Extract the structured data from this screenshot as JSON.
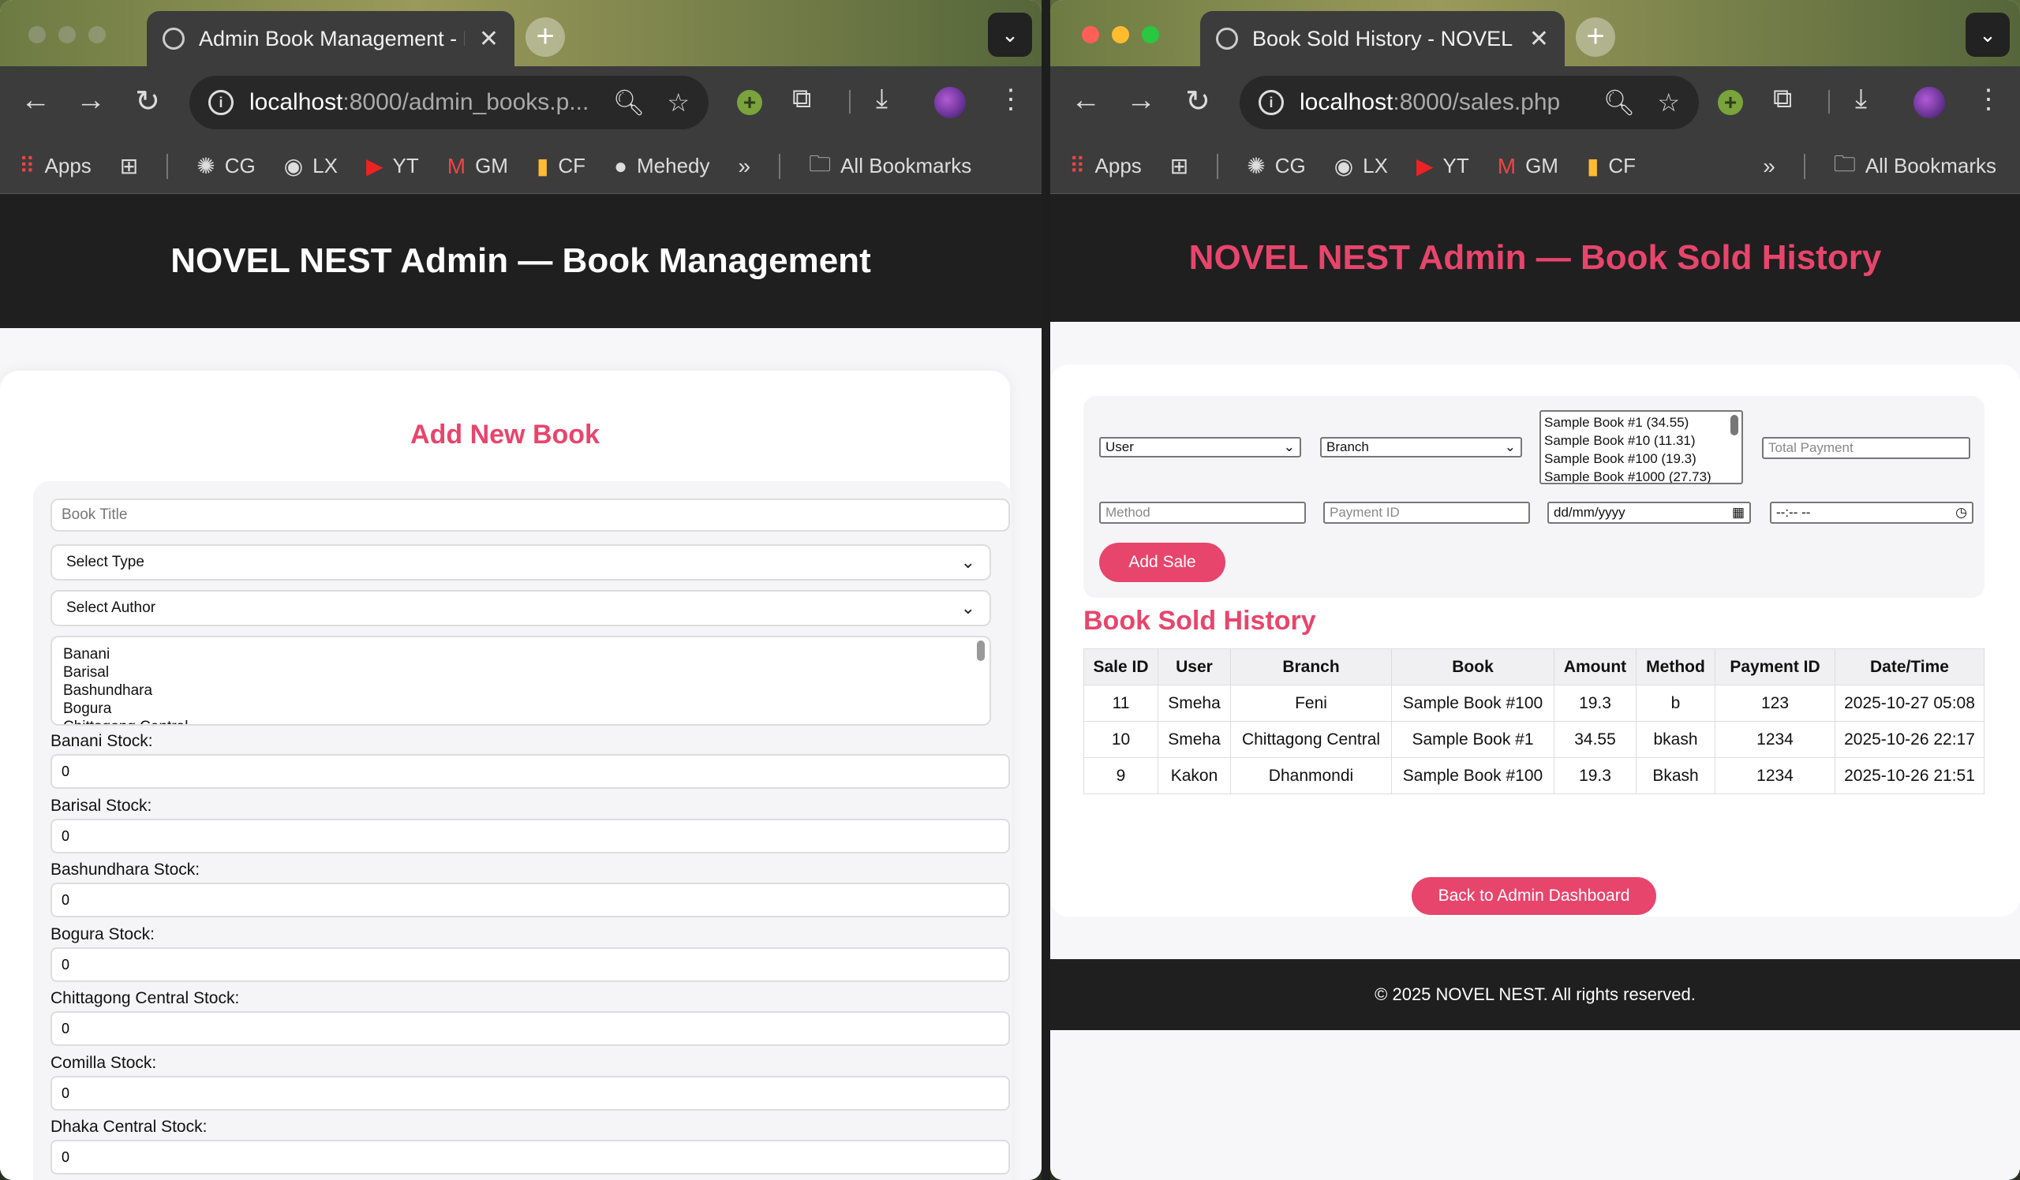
{
  "left": {
    "tab_title": "Admin Book Management - N",
    "url_host": "localhost",
    "url_path": ":8000/admin_books.p...",
    "bookmarks": [
      "Apps",
      "CG",
      "LX",
      "YT",
      "GM",
      "CF",
      "Mehedy",
      "All Bookmarks"
    ],
    "header": "NOVEL NEST Admin — Book Management",
    "card_title": "Add New Book",
    "book_title_placeholder": "Book Title",
    "select_type": "Select Type",
    "select_author": "Select Author",
    "branches": [
      "Banani",
      "Barisal",
      "Bashundhara",
      "Bogura",
      "Chittagong Central"
    ],
    "stocks": [
      {
        "label": "Banani Stock:",
        "value": "0"
      },
      {
        "label": "Barisal Stock:",
        "value": "0"
      },
      {
        "label": "Bashundhara Stock:",
        "value": "0"
      },
      {
        "label": "Bogura Stock:",
        "value": "0"
      },
      {
        "label": "Chittagong Central Stock:",
        "value": "0"
      },
      {
        "label": "Comilla Stock:",
        "value": "0"
      },
      {
        "label": "Dhaka Central Stock:",
        "value": "0"
      }
    ]
  },
  "right": {
    "tab_title": "Book Sold History - NOVEL N",
    "url_host": "localhost",
    "url_path": ":8000/sales.php",
    "bookmarks": [
      "Apps",
      "CG",
      "LX",
      "YT",
      "GM",
      "CF",
      "All Bookmarks"
    ],
    "header": "NOVEL NEST Admin — Book Sold History",
    "user_select": "User",
    "branch_select": "Branch",
    "book_options": [
      "Sample Book #1 (34.55)",
      "Sample Book #10 (11.31)",
      "Sample Book #100 (19.3)",
      "Sample Book #1000 (27.73)"
    ],
    "total_payment_placeholder": "Total Payment",
    "method_placeholder": "Method",
    "payment_id_placeholder": "Payment ID",
    "date_placeholder": "dd/mm/yyyy",
    "time_placeholder": "--:-- --",
    "add_sale_label": "Add Sale",
    "history_title": "Book Sold History",
    "columns": [
      "Sale ID",
      "User",
      "Branch",
      "Book",
      "Amount",
      "Method",
      "Payment ID",
      "Date/Time"
    ],
    "rows": [
      [
        "11",
        "Smeha",
        "Feni",
        "Sample Book #100",
        "19.3",
        "b",
        "123",
        "2025-10-27 05:08"
      ],
      [
        "10",
        "Smeha",
        "Chittagong Central",
        "Sample Book #1",
        "34.55",
        "bkash",
        "1234",
        "2025-10-26 22:17"
      ],
      [
        "9",
        "Kakon",
        "Dhanmondi",
        "Sample Book #100",
        "19.3",
        "Bkash",
        "1234",
        "2025-10-26 21:51"
      ]
    ],
    "back_label": "Back to Admin Dashboard",
    "footer": "© 2025 NOVEL NEST. All rights reserved."
  },
  "colors": {
    "accent": "#e8456c",
    "dark": "#1f1f1f"
  }
}
